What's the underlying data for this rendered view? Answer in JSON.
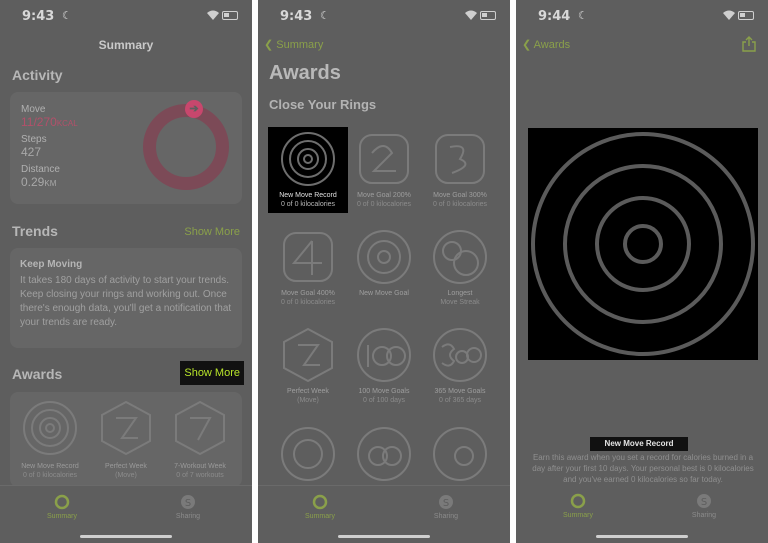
{
  "screen1": {
    "status_time": "9:43",
    "nav_title": "Summary",
    "activity": {
      "heading": "Activity",
      "move_label": "Move",
      "move_value": "11/270",
      "move_unit": "KCAL",
      "steps_label": "Steps",
      "steps_value": "427",
      "distance_label": "Distance",
      "distance_value": "0.29",
      "distance_unit": "KM"
    },
    "trends": {
      "heading": "Trends",
      "show_more": "Show More",
      "card_title": "Keep Moving",
      "card_body": "It takes 180 days of activity to start your trends. Keep closing your rings and working out. Once there's enough data, you'll get a notification that your trends are ready."
    },
    "awards": {
      "heading": "Awards",
      "show_more": "Show More",
      "badges": [
        {
          "name": "New Move Record",
          "detail": "0 of 0 kilocalories"
        },
        {
          "name": "Perfect Week",
          "detail": "(Move)"
        },
        {
          "name": "7-Workout Week",
          "detail": "0 of 7 workouts"
        }
      ]
    },
    "tabs": [
      {
        "label": "Summary"
      },
      {
        "label": "Sharing"
      }
    ]
  },
  "screen2": {
    "status_time": "9:43",
    "back_label": "Summary",
    "title": "Awards",
    "section": "Close Your Rings",
    "badges": [
      {
        "name": "New Move Record",
        "detail": "0 of 0 kilocalories",
        "selected": true
      },
      {
        "name": "Move Goal 200%",
        "detail": "0 of 0 kilocalories"
      },
      {
        "name": "Move Goal 300%",
        "detail": "0 of 0 kilocalories"
      },
      {
        "name": "Move Goal 400%",
        "detail": "0 of 0 kilocalories"
      },
      {
        "name": "New Move Goal",
        "detail": ""
      },
      {
        "name": "Longest",
        "detail": "Move Streak"
      },
      {
        "name": "Perfect Week",
        "detail": "(Move)"
      },
      {
        "name": "100 Move Goals",
        "detail": "0 of 100 days"
      },
      {
        "name": "365 Move Goals",
        "detail": "0 of 365 days"
      }
    ],
    "tabs": [
      {
        "label": "Summary"
      },
      {
        "label": "Sharing"
      }
    ]
  },
  "screen3": {
    "status_time": "9:44",
    "back_label": "Awards",
    "award_title": "New Move Record",
    "award_description": "Earn this award when you set a record for calories burned in a day after your first 10 days. Your personal best is 0 kilocalories and you've earned 0 kilocalories so far today.",
    "tabs": [
      {
        "label": "Summary"
      },
      {
        "label": "Sharing"
      }
    ]
  },
  "colors": {
    "accent_green": "#b9e62a",
    "move_red": "#c8476d",
    "overlay_gray": "#5e5e5e"
  }
}
